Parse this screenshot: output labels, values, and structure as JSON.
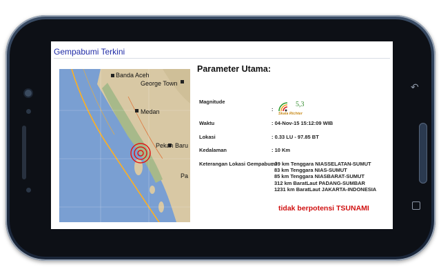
{
  "app": {
    "title": "Gempabumi Terkini"
  },
  "map": {
    "labels": [
      {
        "name": "banda-aceh",
        "text": "Banda Aceh"
      },
      {
        "name": "george-town",
        "text": "George Town"
      },
      {
        "name": "medan",
        "text": "Medan"
      },
      {
        "name": "pekanbaru",
        "text": "Pekan Baru"
      },
      {
        "name": "padang",
        "text": "Pa"
      }
    ],
    "colors": {
      "sea": "#7a9fd2",
      "land": "#d8c8a4",
      "epicenter": "#e01818",
      "fault": "#ffb020"
    }
  },
  "params": {
    "title": "Parameter Utama:",
    "magnitude": {
      "label": "Magnitude",
      "colon": ":",
      "value": "5,3",
      "scale_caption": "Skala Richter"
    },
    "waktu": {
      "label": "Waktu",
      "value": ": 04-Nov-15 15:12:09 WIB"
    },
    "lokasi": {
      "label": "Lokasi",
      "value": ": 0.33 LU - 97.85 BT"
    },
    "kedalaman": {
      "label": "Kedalaman",
      "value": ": 10 Km"
    },
    "keterangan": {
      "label": "Keterangan Lokasi Gempabumi",
      "lines": [
        ": 39 km Tenggara NIASSELATAN-SUMUT",
        "83 km Tenggara NIAS-SUMUT",
        "85 km Tenggara NIASBARAT-SUMUT",
        "312 km BaratLaut PADANG-SUMBAR",
        "1231 km BaratLaut JAKARTA-INDONESIA"
      ]
    },
    "tsunami": "tidak berpotensi TSUNAMI"
  }
}
